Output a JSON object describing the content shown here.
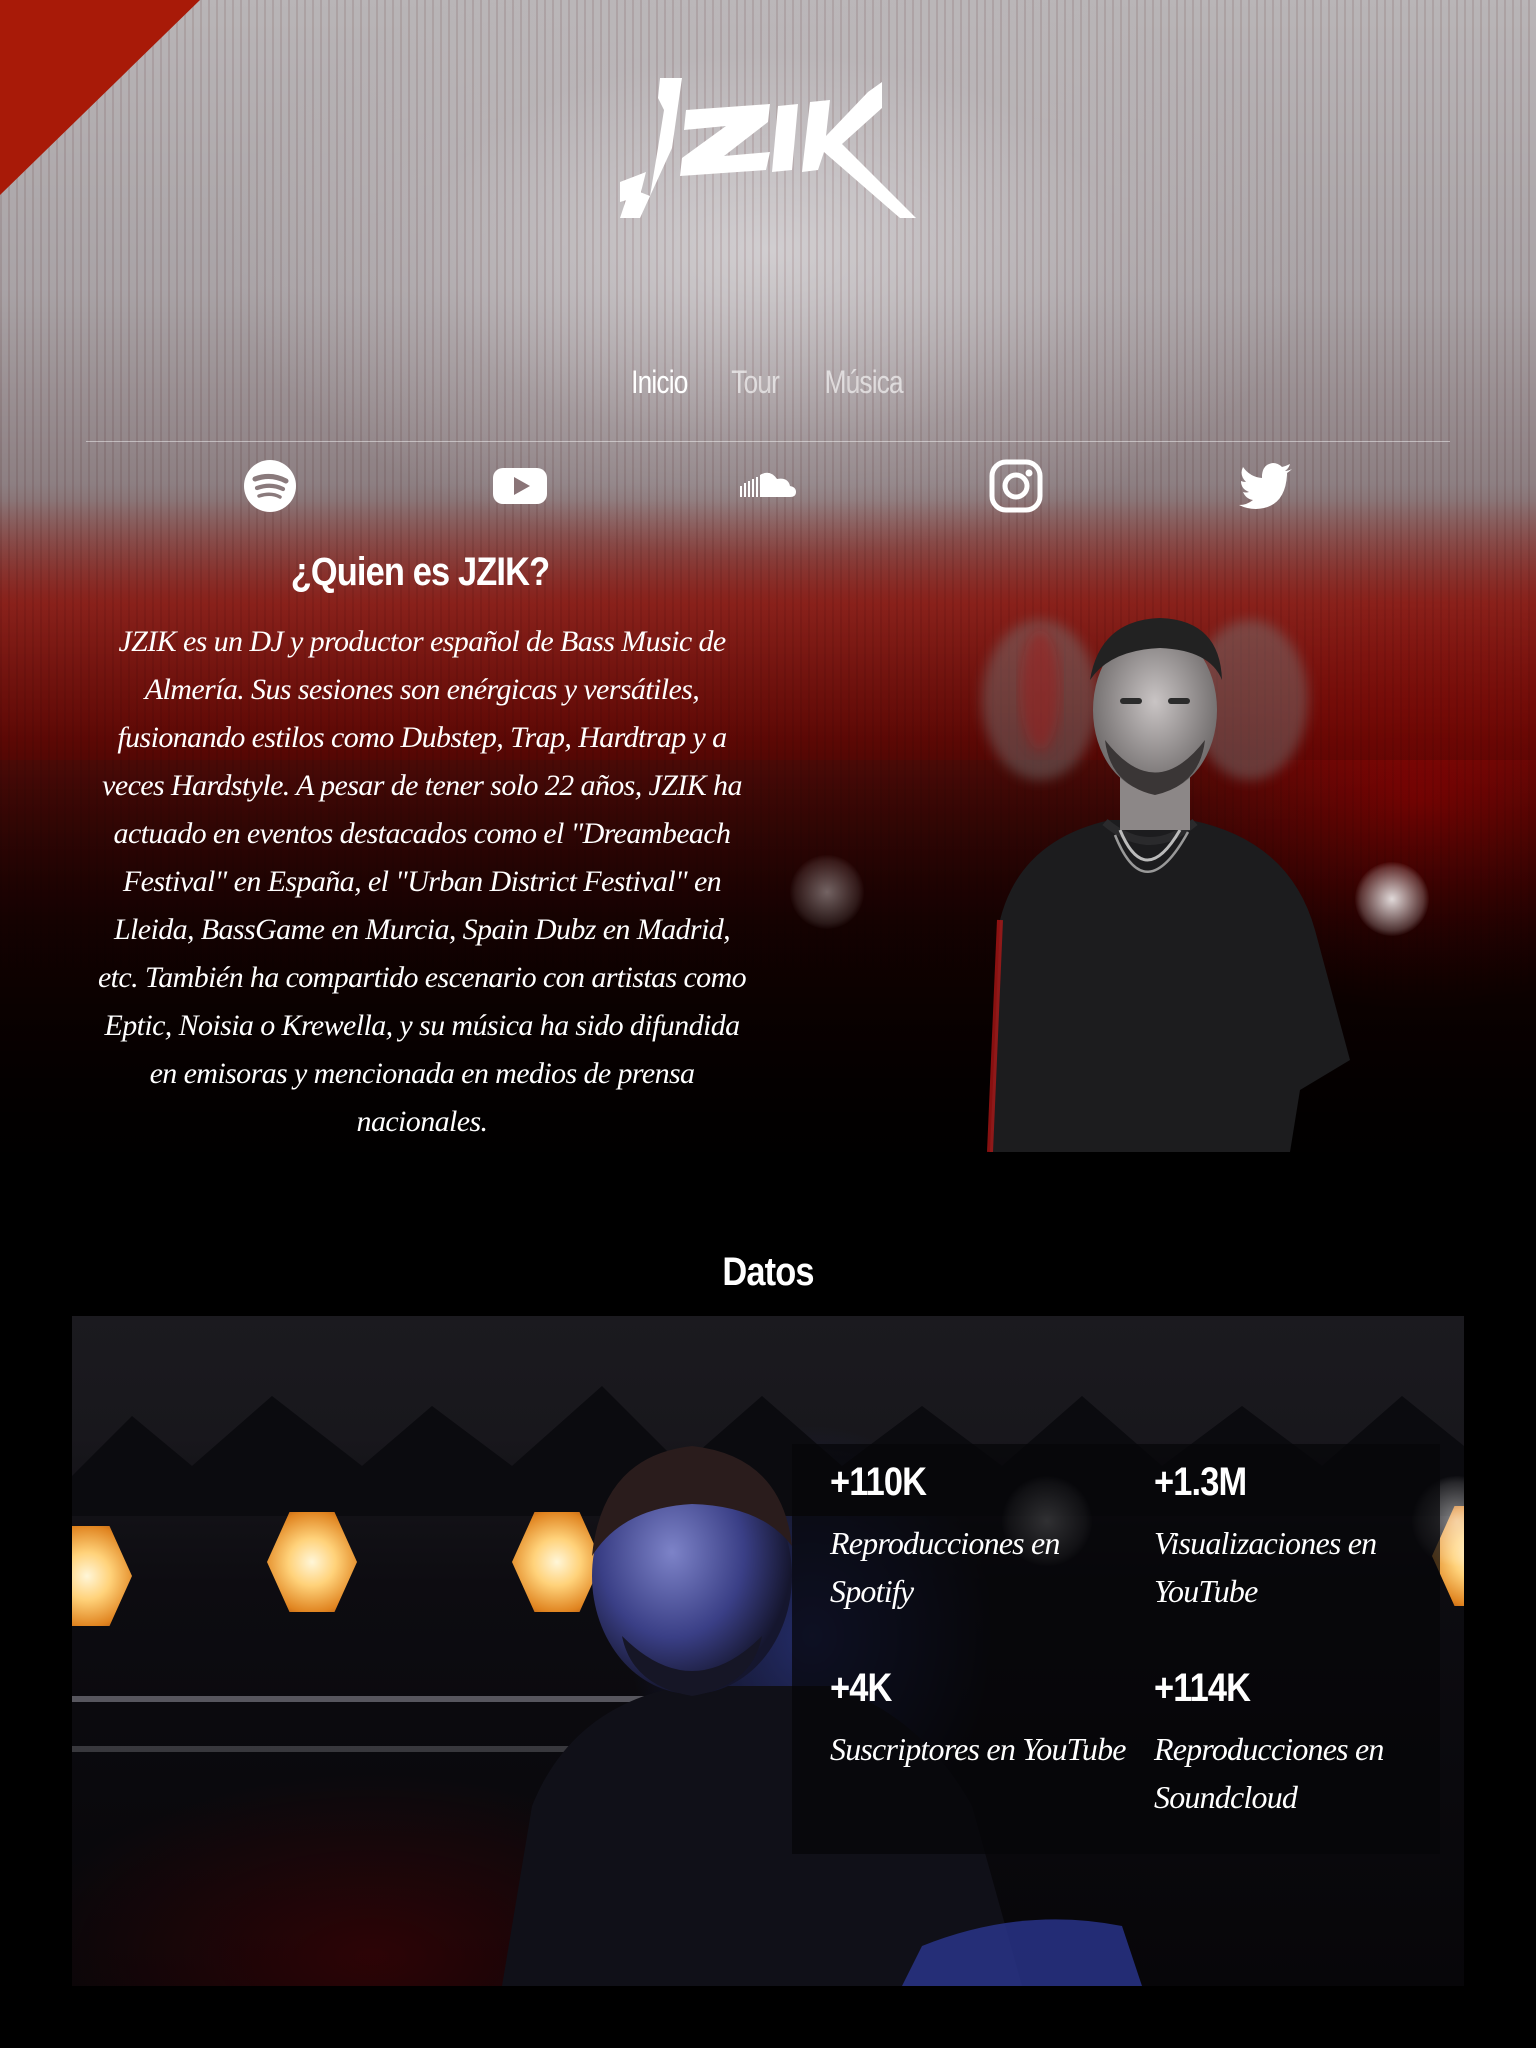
{
  "brand": {
    "logo_text": "JZIK"
  },
  "nav": {
    "items": [
      {
        "label": "Inicio",
        "active": true
      },
      {
        "label": "Tour",
        "active": false
      },
      {
        "label": "Música",
        "active": false
      }
    ]
  },
  "social": [
    {
      "icon": "spotify-icon"
    },
    {
      "icon": "youtube-icon"
    },
    {
      "icon": "soundcloud-icon"
    },
    {
      "icon": "instagram-icon"
    },
    {
      "icon": "twitter-icon"
    }
  ],
  "about": {
    "title": "¿Quien es JZIK?",
    "text": "JZIK es un DJ y productor español de Bass Music de Almería. Sus sesiones son enérgicas y versátiles, fusionando estilos como Dubstep, Trap, Hardtrap y a veces Hardstyle. A pesar de tener solo 22 años, JZIK ha actuado en eventos destacados como el \"Dreambeach Festival\" en España, el \"Urban District Festival\" en Lleida, BassGame en Murcia, Spain Dubz en Madrid, etc. También ha compartido escenario con artistas como Eptic, Noisia o Krewella, y su música ha sido difundida en emisoras y mencionada en medios de prensa nacionales."
  },
  "datos": {
    "title": "Datos",
    "stats": [
      {
        "value": "+110K",
        "label": "Reproducciones en Spotify"
      },
      {
        "value": "+1.3M",
        "label": "Visualizaciones en YouTube"
      },
      {
        "value": "+4K",
        "label": "Suscriptores en YouTube"
      },
      {
        "value": "+114K",
        "label": "Reproducciones en Soundcloud"
      }
    ]
  },
  "colors": {
    "accent_red": "#a81a08",
    "background": "#000000",
    "text": "#ffffff"
  }
}
